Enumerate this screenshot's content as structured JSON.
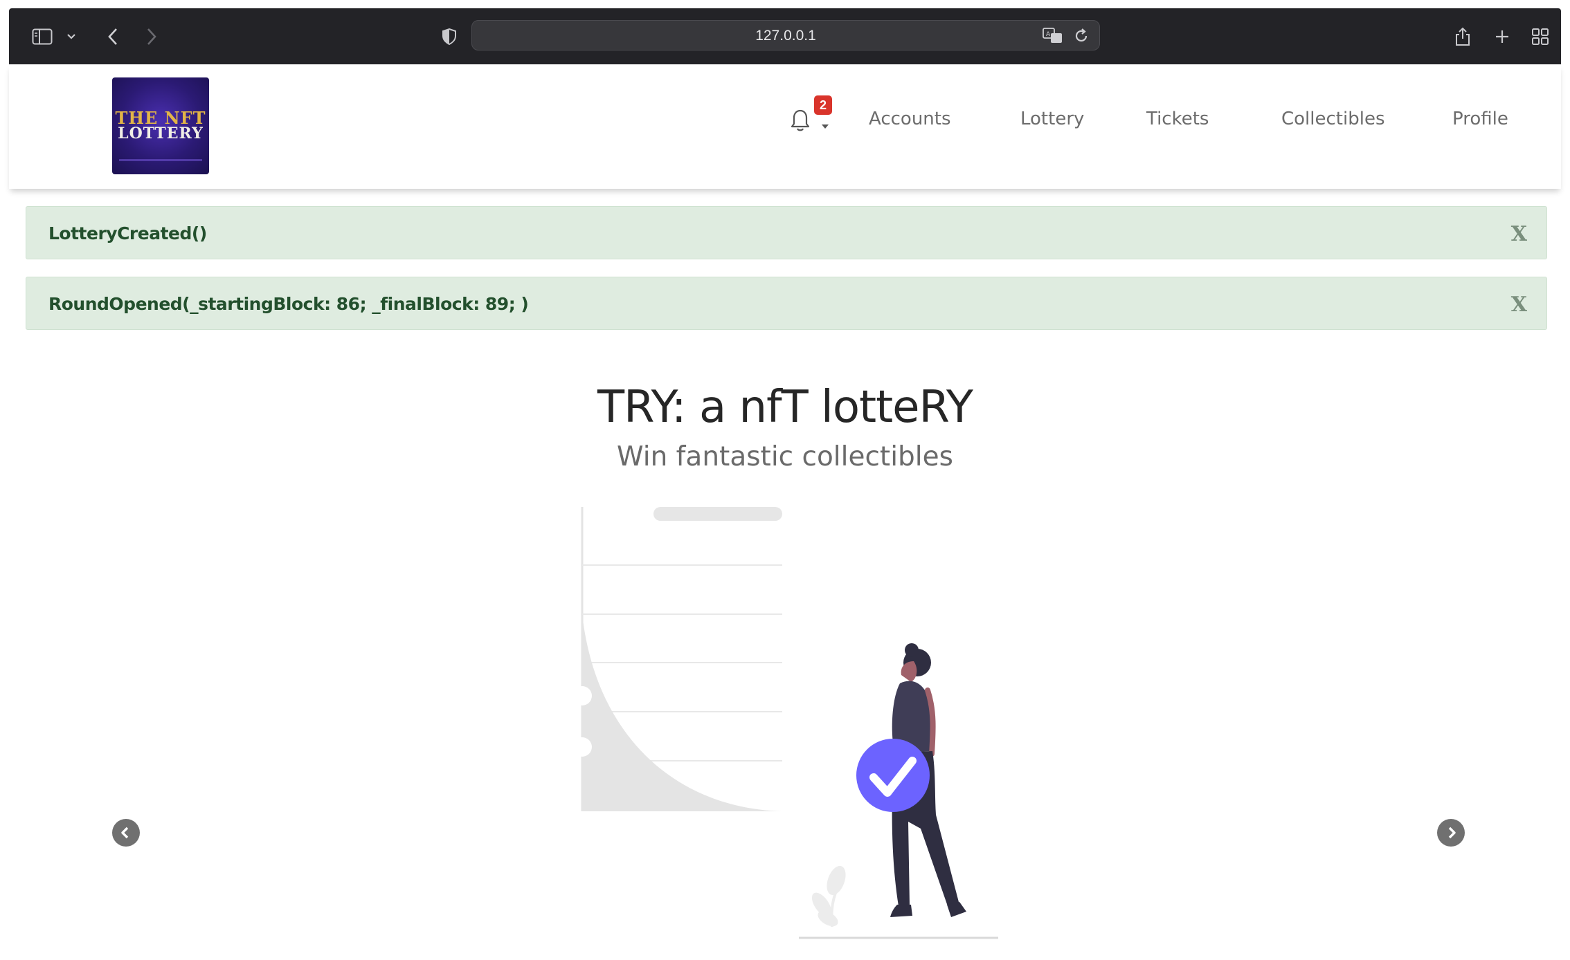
{
  "browser": {
    "url": "127.0.0.1"
  },
  "header": {
    "logo": {
      "line1": "THE NFT",
      "line2": "LOTTERY"
    },
    "notification_count": "2",
    "nav": [
      "Accounts",
      "Lottery",
      "Tickets",
      "Collectibles",
      "Profile"
    ]
  },
  "alerts": [
    {
      "text": "LotteryCreated()",
      "close": "X"
    },
    {
      "text": "RoundOpened(_startingBlock: 86; _finalBlock: 89; )",
      "close": "X"
    }
  ],
  "hero": {
    "title": "TRY: a nfT lotteRY",
    "subtitle": "Win fantastic collectibles"
  },
  "icons": {
    "sidebar": "sidebar-icon",
    "back": "chevron-left-icon",
    "forward": "chevron-right-icon",
    "privacy": "shield-icon",
    "translate": "translate-icon",
    "reload": "reload-icon",
    "share": "share-icon",
    "new_tab": "plus-icon",
    "tabs": "tab-overview-icon",
    "bell": "bell-icon",
    "caret": "caret-down-icon",
    "prev": "carousel-prev-icon",
    "next": "carousel-next-icon"
  },
  "colors": {
    "browser_bar": "#232327",
    "alert_bg": "#dfece0",
    "alert_text": "#23502d",
    "badge": "#d9342b",
    "accent": "#6c63ff",
    "nav_text": "#6c6c6c"
  }
}
